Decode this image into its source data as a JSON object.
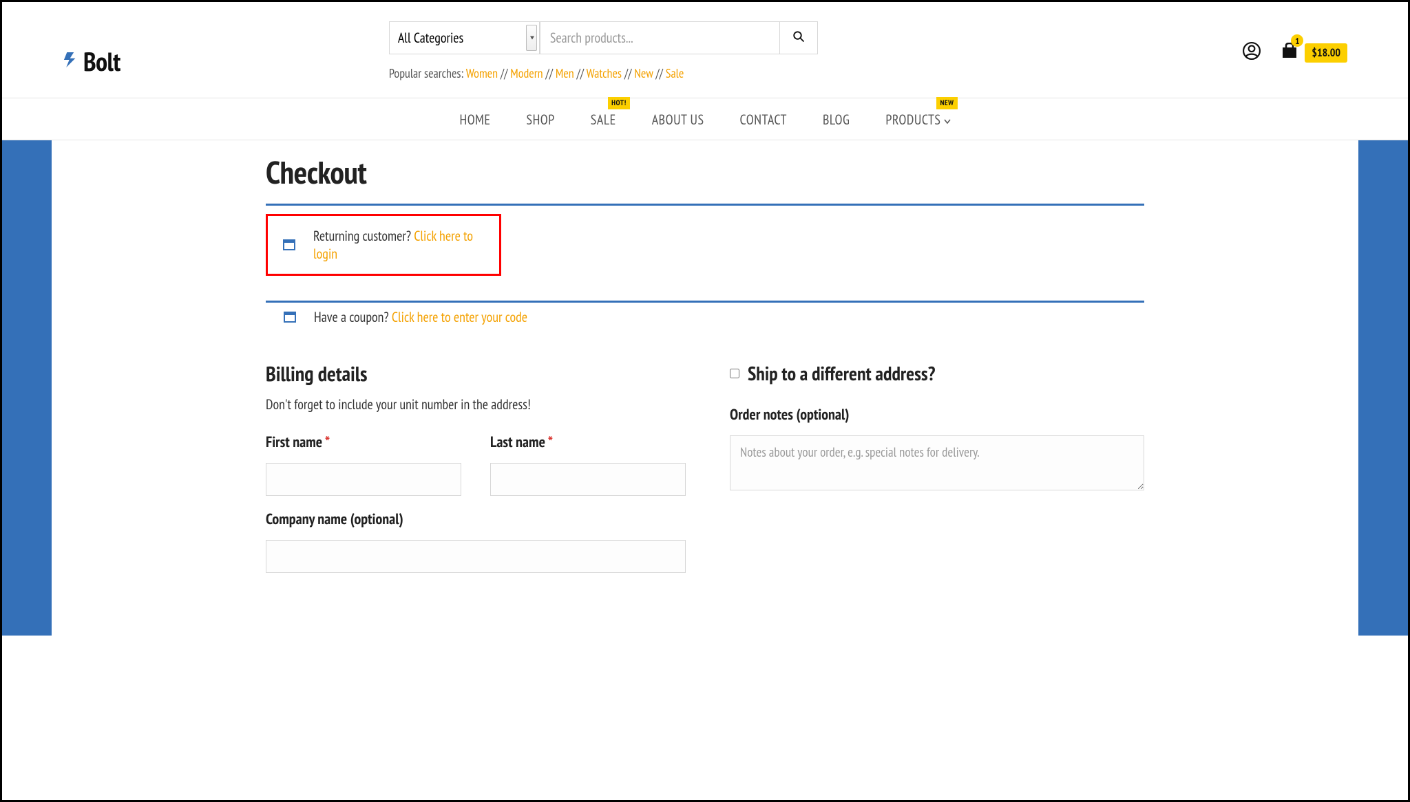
{
  "logo_text": "Bolt",
  "search": {
    "category_selected": "All Categories",
    "placeholder": "Search products..."
  },
  "popular": {
    "label": "Popular searches: ",
    "links": [
      "Women",
      "Modern",
      "Men",
      "Watches",
      "New",
      "Sale"
    ]
  },
  "cart": {
    "count": "1",
    "total": "$18.00"
  },
  "nav": {
    "home": "HOME",
    "shop": "SHOP",
    "sale": "SALE",
    "sale_badge": "HOT!",
    "about": "ABOUT US",
    "contact": "CONTACT",
    "blog": "BLOG",
    "products": "PRODUCTS",
    "products_badge": "NEW"
  },
  "page": {
    "title": "Checkout"
  },
  "notices": {
    "returning_text": "Returning customer? ",
    "returning_link": "Click here to login",
    "coupon_text": "Have a coupon? ",
    "coupon_link": "Click here to enter your code"
  },
  "billing": {
    "title": "Billing details",
    "subtitle": "Don't forget to include your unit number in the address!",
    "first_name": "First name ",
    "last_name": "Last name ",
    "company_name": "Company name (optional)"
  },
  "shipping": {
    "ship_diff": "Ship to a different address?",
    "notes_label": "Order notes (optional)",
    "notes_placeholder": "Notes about your order, e.g. special notes for delivery."
  }
}
